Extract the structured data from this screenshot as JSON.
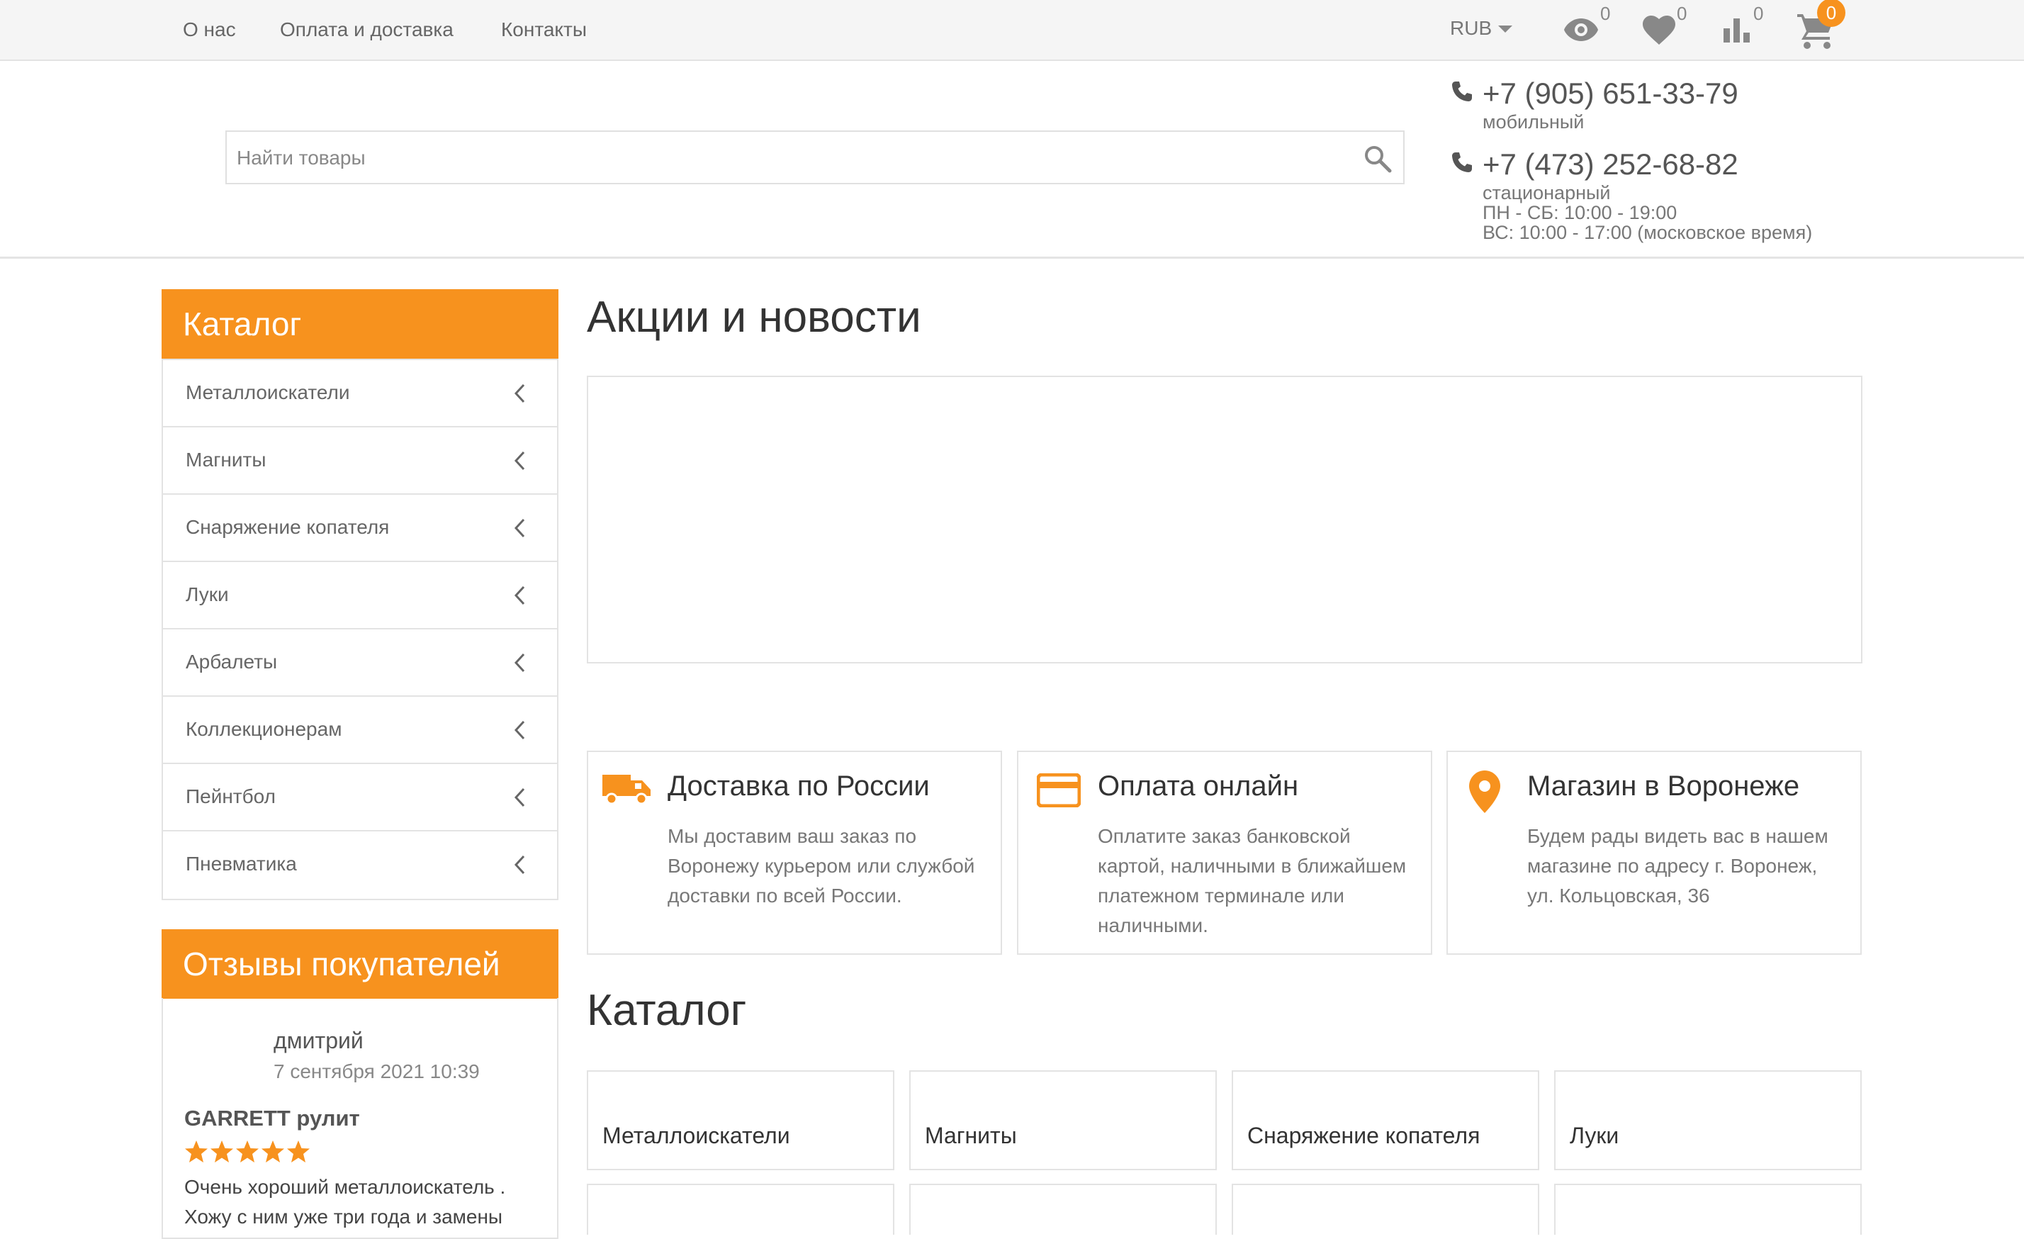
{
  "topnav": {
    "items": [
      "О нас",
      "Оплата и доставка",
      "Контакты"
    ]
  },
  "header_icons": {
    "currency": "RUB",
    "viewed_count": "0",
    "favorites_count": "0",
    "compare_count": "0",
    "cart_count": "0"
  },
  "search": {
    "placeholder": "Найти товары",
    "value": ""
  },
  "contacts": {
    "phone1": "+7 (905) 651-33-79",
    "phone1_label": "мобильный",
    "phone2": "+7 (473) 252-68-82",
    "phone2_label": "стационарный",
    "hours1": "ПН - СБ: 10:00 - 19:00",
    "hours2": "ВС: 10:00 - 17:00 (московское время)"
  },
  "sidebar": {
    "catalog_title": "Каталог",
    "categories": [
      "Металлоискатели",
      "Магниты",
      "Снаряжение копателя",
      "Луки",
      "Арбалеты",
      "Коллекционерам",
      "Пейнтбол",
      "Пневматика"
    ],
    "reviews_title": "Отзывы покупателей",
    "review": {
      "author": "дмитрий",
      "date": "7 сентября 2021 10:39",
      "title": "GARRETT рулит",
      "stars": 5,
      "text": "Очень хороший металлоискатель . Хожу с ним уже три года и замены"
    }
  },
  "main": {
    "promo_title": "Акции и новости",
    "features": [
      {
        "title": "Доставка по России",
        "text": "Мы доставим ваш заказ по Воронежу курьером или службой доставки по всей России.",
        "icon": "truck-icon"
      },
      {
        "title": "Оплата онлайн",
        "text": "Оплатите заказ банковской картой, наличными в ближайшем платежном терминале или наличными.",
        "icon": "credit-card-icon"
      },
      {
        "title": "Магазин в Воронеже",
        "text": "Будем рады видеть вас в нашем магазине по адресу г. Воронеж, ул. Кольцовская, 36",
        "icon": "map-pin-icon"
      }
    ],
    "catalog_title": "Каталог",
    "catalog_tiles": [
      "Металлоискатели",
      "Магниты",
      "Снаряжение копателя",
      "Луки"
    ]
  },
  "colors": {
    "accent": "#f7921e",
    "border": "#e3e3e3",
    "topbar_bg": "#f5f5f5"
  }
}
